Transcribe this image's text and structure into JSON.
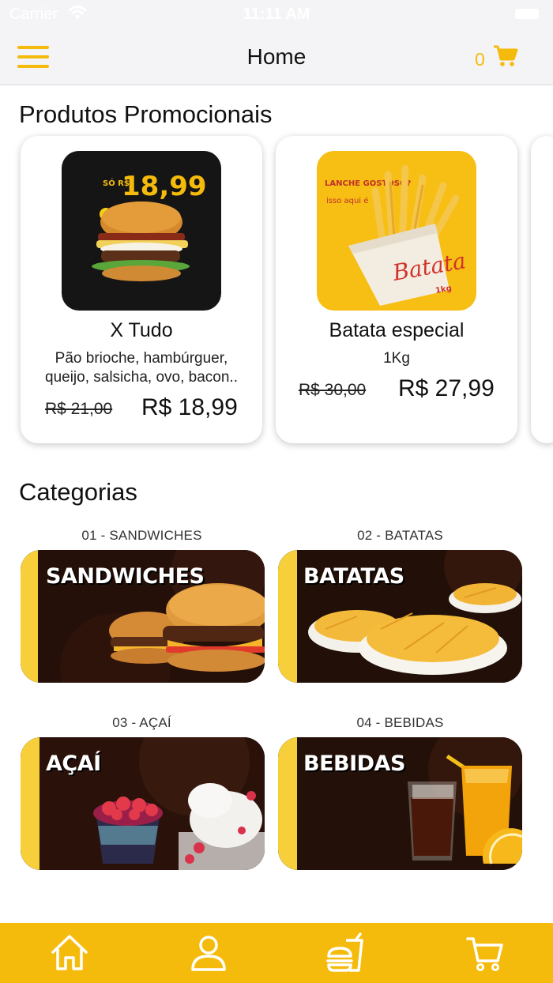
{
  "theme": {
    "accent": "#f5bb0c",
    "text": "#111111",
    "status_bar_bg": "#f4f4f6"
  },
  "status_bar": {
    "carrier": "Carrier",
    "time": "11:11 AM"
  },
  "nav": {
    "title": "Home",
    "cart_count": "0",
    "menu_icon": "hamburger-menu-icon",
    "cart_icon": "shopping-cart-icon"
  },
  "promotions": {
    "title": "Produtos Promocionais",
    "items": [
      {
        "name": "X Tudo",
        "description": "Pão brioche, hambúrguer, queijo, salsicha, ovo, bacon..",
        "old_price": "R$ 21,00",
        "price": "R$ 18,99",
        "image_badge_prefix": "SÓ R$",
        "image_badge_price": "18,99"
      },
      {
        "name": "Batata especial",
        "description": "1Kg",
        "old_price": "R$ 30,00",
        "price": "R$ 27,99",
        "image_text_1": "LANCHE GOSTOSO?",
        "image_text_2": "isso aqui é",
        "image_text_3": "Batata",
        "image_text_4": "1kg"
      }
    ]
  },
  "categories": {
    "title": "Categorias",
    "items": [
      {
        "label": "01 - SANDWICHES",
        "banner_text": "SANDWICHES"
      },
      {
        "label": "02 - BATATAS",
        "banner_text": "BATATAS"
      },
      {
        "label": "03 - AÇAÍ",
        "banner_text": "AÇAÍ"
      },
      {
        "label": "04 - BEBIDAS",
        "banner_text": "BEBIDAS"
      }
    ]
  },
  "tab_bar": {
    "items": [
      {
        "icon": "home-icon"
      },
      {
        "icon": "user-icon"
      },
      {
        "icon": "burger-drink-icon"
      },
      {
        "icon": "cart-icon"
      }
    ]
  }
}
